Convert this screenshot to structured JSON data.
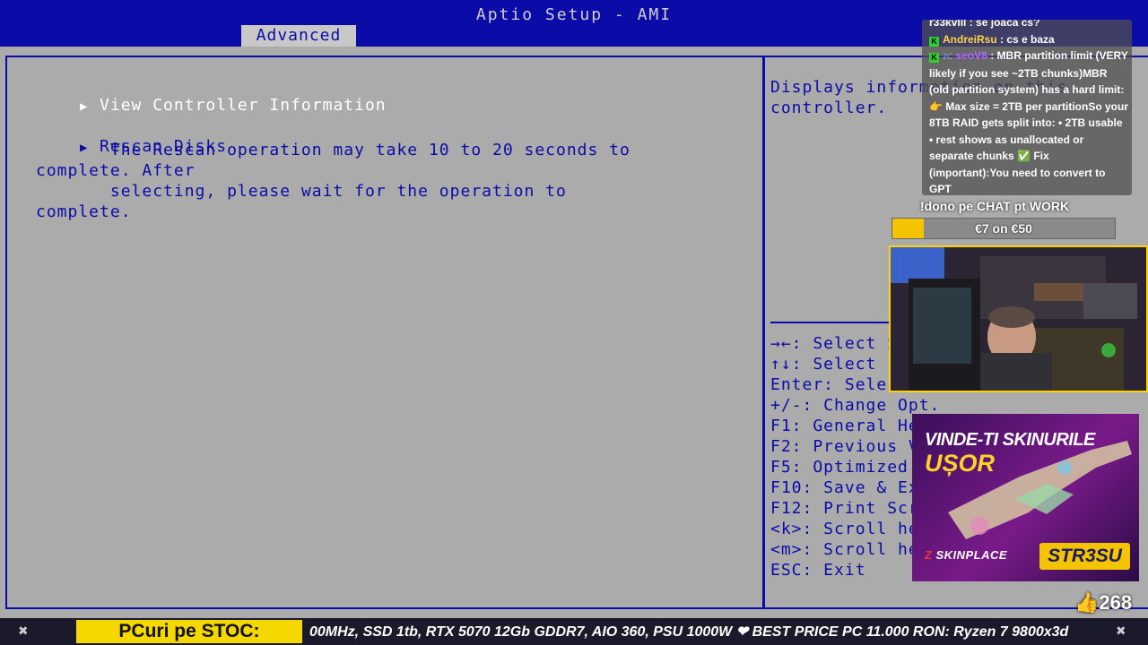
{
  "bios": {
    "title": "Aptio Setup - AMI",
    "tab_label": "Advanced",
    "menu": [
      {
        "label": "View Controller Information",
        "selected": true
      },
      {
        "label": "Rescan Disks",
        "selected": false
      }
    ],
    "description": "       The Rescan operation may take 10 to 20 seconds to\ncomplete. After\n       selecting, please wait for the operation to\ncomplete.",
    "help_text": "Displays information on this\ncontroller.",
    "keys": [
      "→←: Select Screen",
      "↑↓: Select Item",
      "Enter: Select",
      "+/-: Change Opt.",
      "F1: General Help",
      "F2: Previous Values",
      "F5: Optimized Defaults",
      "F10: Save & Exit",
      "F12: Print Screen",
      "<k>: Scroll help area upwards",
      "<m>: Scroll help area downwards",
      "ESC: Exit"
    ],
    "colors": {
      "header": "#0b0ba8",
      "body": "#ababab",
      "text_blue": "#0b0ba8"
    }
  },
  "overlay": {
    "chat": [
      {
        "user": "r33kvlll",
        "text": "se joaca cs?"
      },
      {
        "user": "AndreiRsu",
        "text": "cs e baza"
      },
      {
        "user": "seoV8",
        "text": "MBR partition limit (VERY likely if you see ~2TB chunks)MBR (old partition system) has a hard limit: 👉 Max size = 2TB per partitionSo your 8TB RAID gets split into: • 2TB usable • rest shows as unallocated or separate chunks ✅ Fix (important):You need to convert to GPT"
      }
    ],
    "dono_label": "!dono pe CHAT pt WORK",
    "dono_amount": "€7 on €50",
    "dono_progress": 0.14,
    "ad_line1": "VINDE-TI SKINURILE",
    "ad_line2": "UȘOR",
    "ad_brand": "SKINPLACE",
    "ad_code": "STR3SU",
    "likes": "268",
    "ticker_label": "PCuri pe STOC:",
    "ticker_text": "00MHz, SSD 1tb, RTX 5070 12Gb GDDR7, AIO 360, PSU 1000W ❤ BEST PRICE PC 11.000 RON: Ryzen 7 9800x3d"
  }
}
